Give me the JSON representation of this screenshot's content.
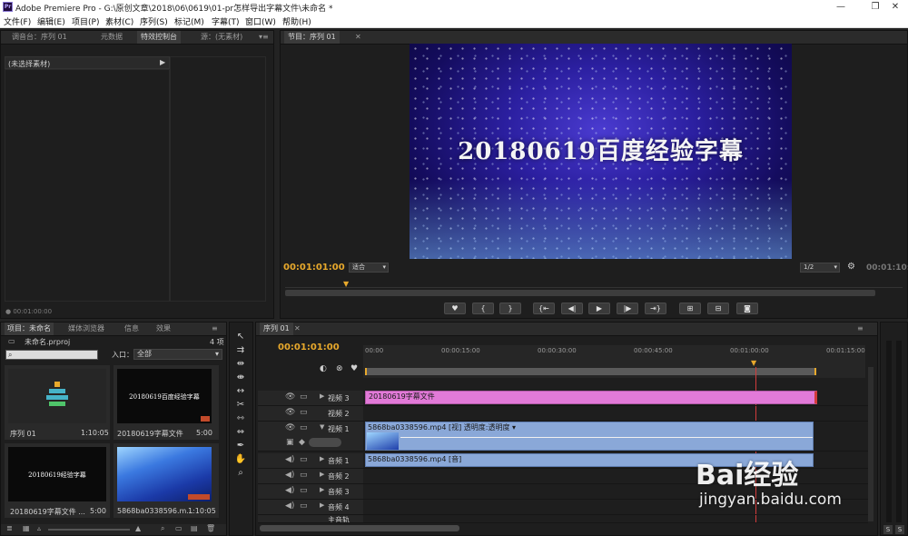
{
  "window": {
    "title": "Adobe Premiere Pro - G:\\原创文章\\2018\\06\\0619\\01-pr怎样导出字幕文件\\未命名 *",
    "logo_text": "Pr",
    "minimize": "—",
    "restore": "❐",
    "close": "✕"
  },
  "menu": [
    "文件(F)",
    "编辑(E)",
    "项目(P)",
    "素材(C)",
    "序列(S)",
    "标记(M)",
    "字幕(T)",
    "窗口(W)",
    "帮助(H)"
  ],
  "source_panel": {
    "tabs": [
      "调音台：序列 01",
      "元数据",
      "特效控制台",
      "源：(无素材)"
    ],
    "active_tab": 2,
    "no_clip": "(未选择素材)",
    "timecode": "00:01:00:00"
  },
  "program": {
    "tab": "节目：序列 01",
    "title_text": "20180619百度经验字幕",
    "timecode": "00:01:01:00",
    "fit": "适合",
    "resolution": "1/2",
    "duration": "00:01:10:"
  },
  "project": {
    "tabs": [
      "项目：未命名",
      "媒体浏览器",
      "信息",
      "效果"
    ],
    "project_file": "未命名.prproj",
    "item_count": "4 项",
    "in_label": "入口：",
    "in_value": "全部",
    "items": [
      {
        "name": "序列 01",
        "duration": "1:10:05"
      },
      {
        "name": "20180619字幕文件",
        "duration": "5:00",
        "thumb_text": "20180619百度经验字幕"
      },
      {
        "name": "20180619字幕文件 ...",
        "duration": "5:00",
        "thumb_text": "20180619经验字幕"
      },
      {
        "name": "5868ba0338596.m...",
        "duration": "1:10:05"
      }
    ]
  },
  "timeline": {
    "tab": "序列 01",
    "timecode": "00:01:01:00",
    "ruler": [
      "00:00",
      "00:00:15:00",
      "00:00:30:00",
      "00:00:45:00",
      "00:01:00:00",
      "00:01:15:00"
    ],
    "tracks": [
      {
        "name": "视频 3",
        "clip": "20180619字幕文件"
      },
      {
        "name": "视频 2",
        "clip": ""
      },
      {
        "name": "视频 1",
        "clip": "5868ba0338596.mp4 [视]  透明度:透明度 ▾"
      },
      {
        "name": "音频 1",
        "clip": "5868ba0338596.mp4 [音]"
      },
      {
        "name": "音频 2",
        "clip": ""
      },
      {
        "name": "音频 3",
        "clip": ""
      },
      {
        "name": "音频 4",
        "clip": ""
      },
      {
        "name": "主音轨",
        "clip": ""
      }
    ]
  },
  "watermark": {
    "text": "Bai经验",
    "url": "jingyan.baidu.com"
  },
  "colors": {
    "accent": "#e8a92c",
    "title_clip": "#e27ad8",
    "video_clip": "#8aa8d8",
    "playhead": "#d23b3b"
  }
}
